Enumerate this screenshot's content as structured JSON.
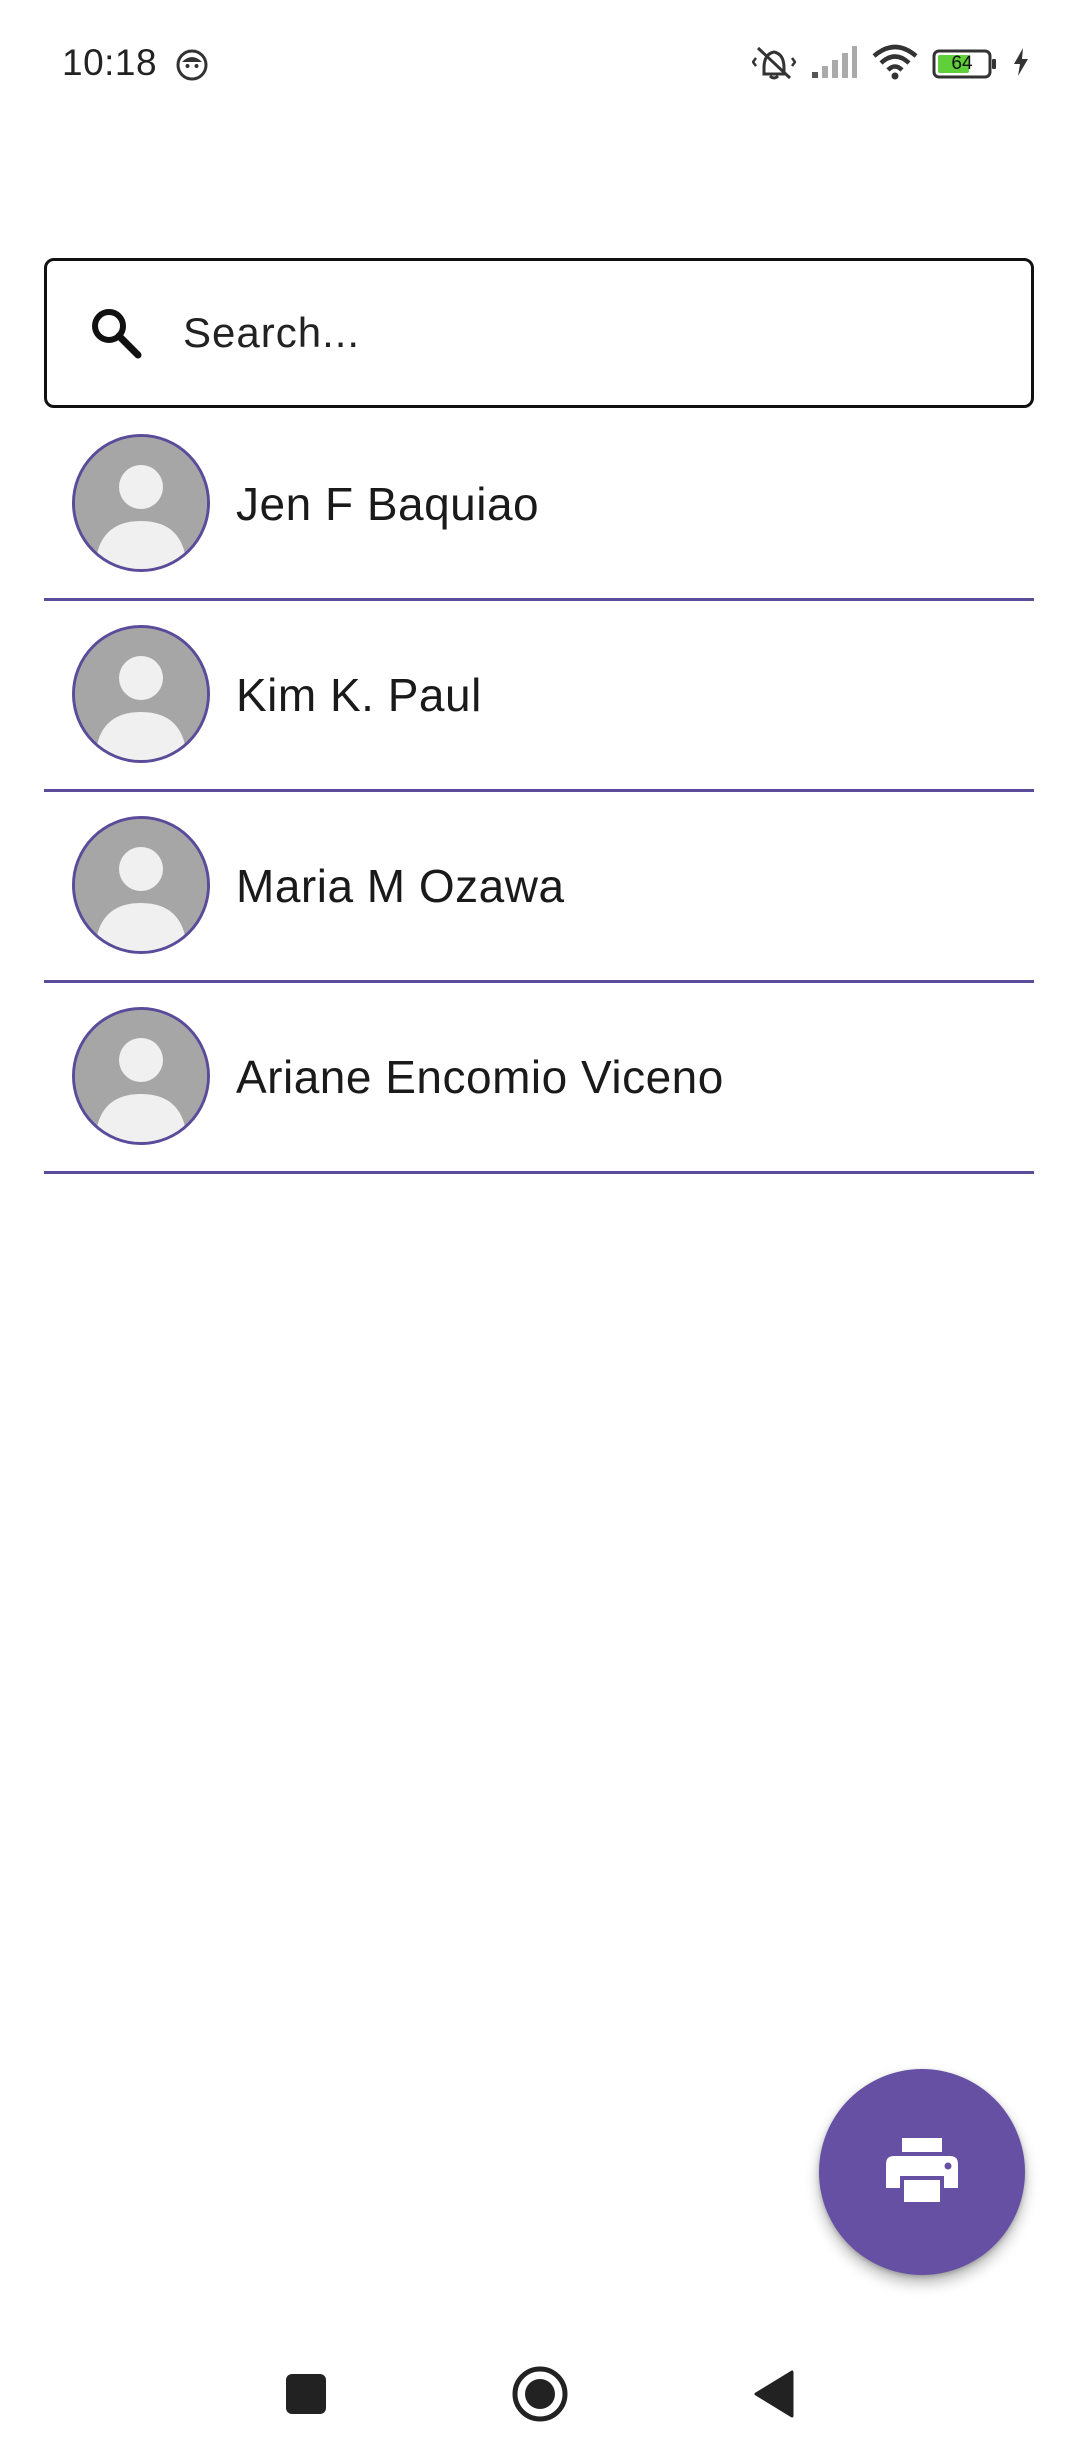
{
  "status_bar": {
    "time": "10:18",
    "battery_level": "64",
    "icons": [
      "face-notification-icon",
      "vibrate-off-icon",
      "signal-icon",
      "wifi-icon",
      "battery-icon",
      "charging-icon"
    ]
  },
  "search": {
    "placeholder": "Search...",
    "value": "",
    "icon": "search-icon"
  },
  "contacts": [
    {
      "name": "Jen F Baquiao",
      "avatar": "default-person-avatar"
    },
    {
      "name": "Kim K. Paul",
      "avatar": "default-person-avatar"
    },
    {
      "name": "Maria M Ozawa",
      "avatar": "default-person-avatar"
    },
    {
      "name": "Ariane Encomio Viceno",
      "avatar": "default-person-avatar"
    }
  ],
  "fab": {
    "icon": "print-icon",
    "color": "#6650a4"
  },
  "navigation": {
    "buttons": [
      "recents-button",
      "home-button",
      "back-button"
    ]
  },
  "colors": {
    "accent": "#6650a4",
    "divider": "#5b4b9b",
    "avatar_bg": "#a6a6a6"
  }
}
